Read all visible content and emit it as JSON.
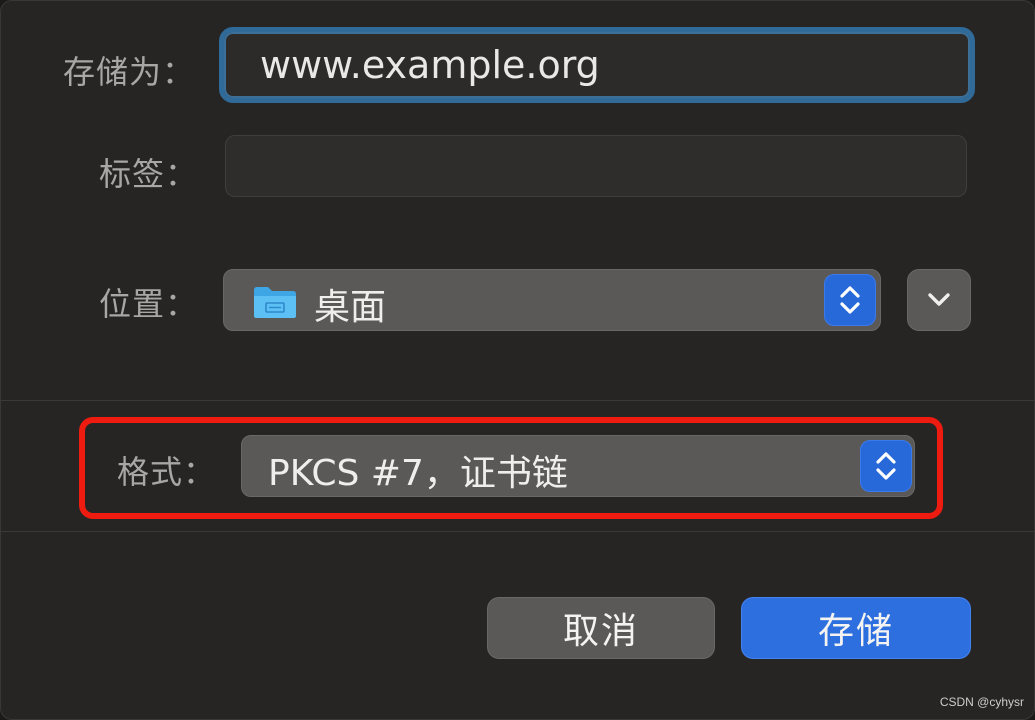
{
  "save_as": {
    "label": "存储为：",
    "value": "www.example.org"
  },
  "tags": {
    "label": "标签：",
    "value": ""
  },
  "location": {
    "label": "位置：",
    "value": "桌面",
    "icon": "folder-icon"
  },
  "format": {
    "label": "格式：",
    "value": "PKCS #7，证书链"
  },
  "buttons": {
    "cancel": "取消",
    "save": "存储"
  },
  "colors": {
    "accent": "#2d6fdf",
    "highlight": "#ee1b10",
    "focus_ring": "#2f6a99"
  },
  "watermark": "CSDN @cyhysr"
}
